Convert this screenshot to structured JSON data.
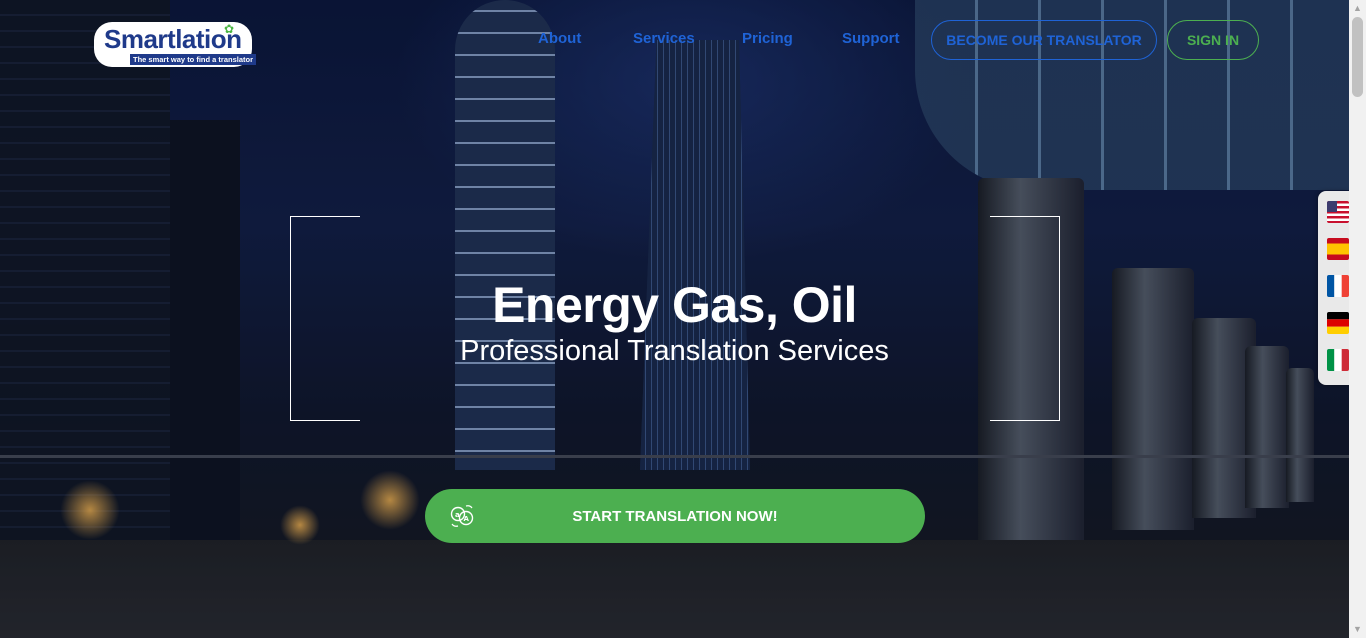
{
  "logo": {
    "wordmark": "Smartlation",
    "tagline": "The smart way to find a translator"
  },
  "nav": {
    "items": [
      {
        "label": "About"
      },
      {
        "label": "Services"
      },
      {
        "label": "Pricing"
      },
      {
        "label": "Support"
      }
    ],
    "become_translator": "BECOME OUR TRANSLATOR",
    "sign_in": "SIGN IN"
  },
  "hero": {
    "title": "Energy Gas, Oil",
    "subtitle": "Professional Translation Services",
    "cta_label": "START TRANSLATION NOW!",
    "cta_icon": "translate-icon"
  },
  "languages": [
    {
      "name": "english-flag-icon"
    },
    {
      "name": "spanish-flag-icon"
    },
    {
      "name": "french-flag-icon"
    },
    {
      "name": "german-flag-icon"
    },
    {
      "name": "italian-flag-icon"
    }
  ],
  "colors": {
    "accent_blue": "#1f63d6",
    "accent_green": "#4caf50"
  }
}
